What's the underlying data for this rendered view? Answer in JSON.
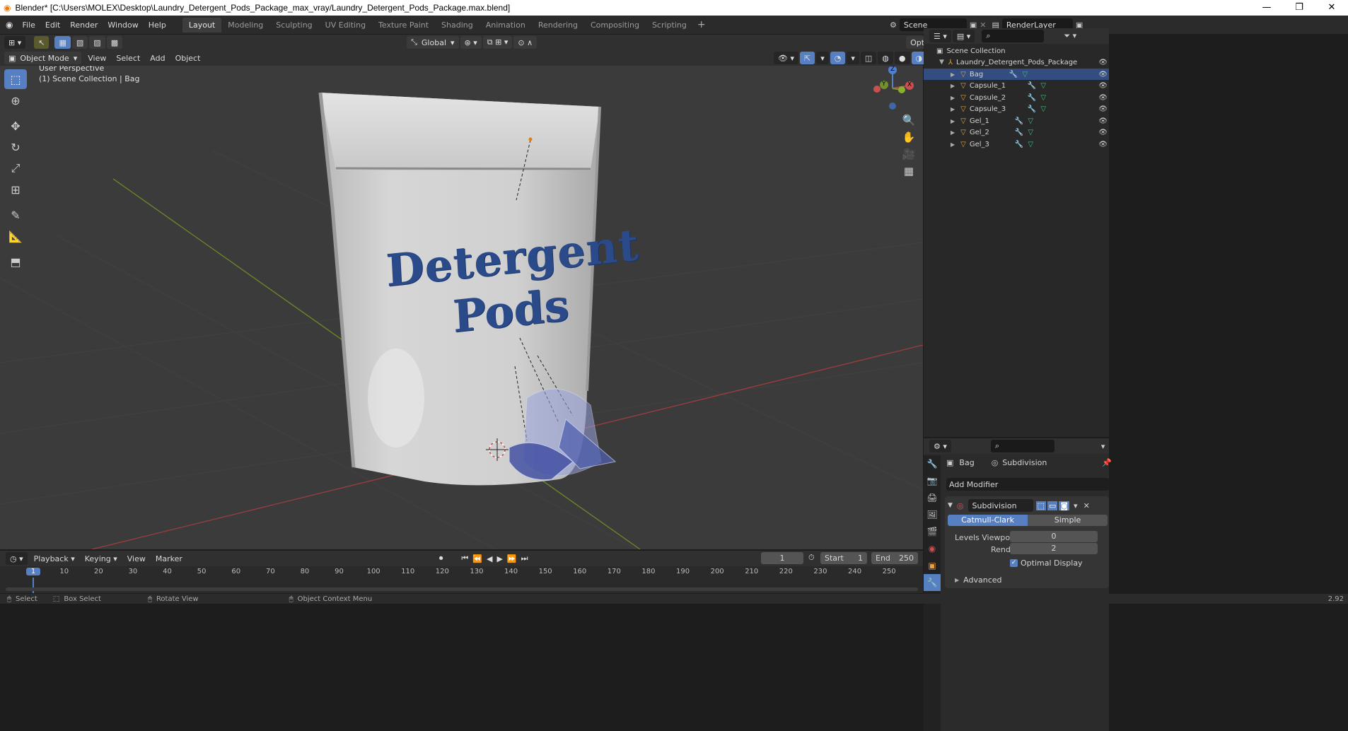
{
  "titlebar": {
    "title": "Blender* [C:\\Users\\MOLEX\\Desktop\\Laundry_Detergent_Pods_Package_max_vray/Laundry_Detergent_Pods_Package.max.blend]",
    "minimize": "—",
    "maximize": "❐",
    "close": "✕"
  },
  "menu": [
    "File",
    "Edit",
    "Render",
    "Window",
    "Help"
  ],
  "workspaces": [
    "Layout",
    "Modeling",
    "Sculpting",
    "UV Editing",
    "Texture Paint",
    "Shading",
    "Animation",
    "Rendering",
    "Compositing",
    "Scripting"
  ],
  "scene": {
    "label": "Scene",
    "renderlayer": "RenderLayer"
  },
  "viewport_header": {
    "transform_orientation": "Global",
    "options": "Options",
    "mode": "Object Mode",
    "menus": [
      "View",
      "Select",
      "Add",
      "Object"
    ]
  },
  "viewport": {
    "perspective": "User Perspective",
    "collection": "(1) Scene Collection | Bag",
    "bag_text_line1": "Detergent",
    "bag_text_line2": "Pods",
    "gizmo": {
      "z": "Z",
      "y": "Y",
      "x": "X"
    }
  },
  "outliner": {
    "root": "Scene Collection",
    "collection": "Laundry_Detergent_Pods_Package",
    "objects": [
      "Bag",
      "Capsule_1",
      "Capsule_2",
      "Capsule_3",
      "Gel_1",
      "Gel_2",
      "Gel_3"
    ]
  },
  "properties": {
    "object": "Bag",
    "modifier_tab": "Subdivision",
    "add_modifier": "Add Modifier",
    "modifier_name": "Subdivision",
    "algo_active": "Catmull-Clark",
    "algo_other": "Simple",
    "levels_viewport_label": "Levels Viewport",
    "levels_viewport": "0",
    "render_label": "Render",
    "render": "2",
    "optimal_display": "Optimal Display",
    "advanced": "Advanced"
  },
  "timeline": {
    "menus": [
      "Playback",
      "Keying",
      "View",
      "Marker"
    ],
    "current_frame": "1",
    "start_label": "Start",
    "start": "1",
    "end_label": "End",
    "end": "250",
    "ruler": [
      "1",
      "10",
      "20",
      "30",
      "40",
      "50",
      "60",
      "70",
      "80",
      "90",
      "100",
      "110",
      "120",
      "130",
      "140",
      "150",
      "160",
      "170",
      "180",
      "190",
      "200",
      "210",
      "220",
      "230",
      "240",
      "250"
    ]
  },
  "statusbar": {
    "select": "Select",
    "box_select": "Box Select",
    "rotate_view": "Rotate View",
    "context_menu": "Object Context Menu",
    "version": "2.92"
  },
  "colors": {
    "accent": "#5680c2",
    "x_axis": "#b34a4a",
    "y_axis": "#7a9a2c",
    "bag_text": "#2a4a8a"
  }
}
